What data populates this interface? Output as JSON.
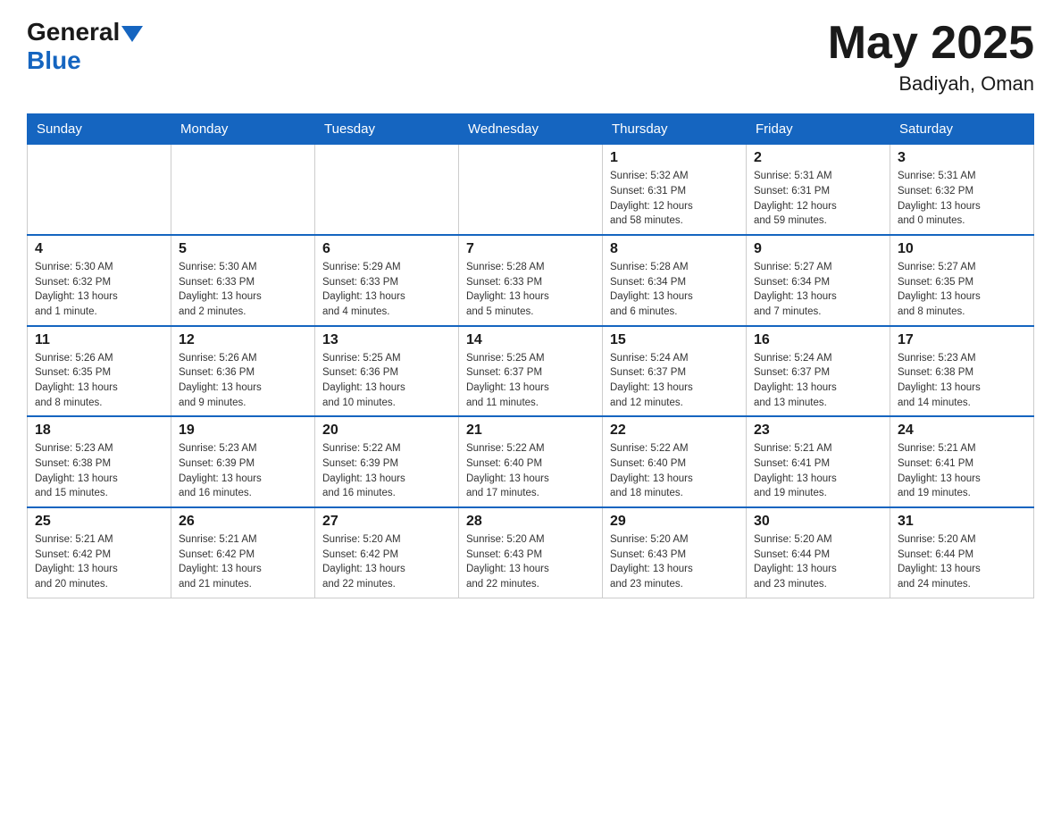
{
  "header": {
    "logo_general": "General",
    "logo_blue": "Blue",
    "month_year": "May 2025",
    "location": "Badiyah, Oman"
  },
  "weekdays": [
    "Sunday",
    "Monday",
    "Tuesday",
    "Wednesday",
    "Thursday",
    "Friday",
    "Saturday"
  ],
  "weeks": [
    [
      {
        "day": "",
        "info": ""
      },
      {
        "day": "",
        "info": ""
      },
      {
        "day": "",
        "info": ""
      },
      {
        "day": "",
        "info": ""
      },
      {
        "day": "1",
        "info": "Sunrise: 5:32 AM\nSunset: 6:31 PM\nDaylight: 12 hours\nand 58 minutes."
      },
      {
        "day": "2",
        "info": "Sunrise: 5:31 AM\nSunset: 6:31 PM\nDaylight: 12 hours\nand 59 minutes."
      },
      {
        "day": "3",
        "info": "Sunrise: 5:31 AM\nSunset: 6:32 PM\nDaylight: 13 hours\nand 0 minutes."
      }
    ],
    [
      {
        "day": "4",
        "info": "Sunrise: 5:30 AM\nSunset: 6:32 PM\nDaylight: 13 hours\nand 1 minute."
      },
      {
        "day": "5",
        "info": "Sunrise: 5:30 AM\nSunset: 6:33 PM\nDaylight: 13 hours\nand 2 minutes."
      },
      {
        "day": "6",
        "info": "Sunrise: 5:29 AM\nSunset: 6:33 PM\nDaylight: 13 hours\nand 4 minutes."
      },
      {
        "day": "7",
        "info": "Sunrise: 5:28 AM\nSunset: 6:33 PM\nDaylight: 13 hours\nand 5 minutes."
      },
      {
        "day": "8",
        "info": "Sunrise: 5:28 AM\nSunset: 6:34 PM\nDaylight: 13 hours\nand 6 minutes."
      },
      {
        "day": "9",
        "info": "Sunrise: 5:27 AM\nSunset: 6:34 PM\nDaylight: 13 hours\nand 7 minutes."
      },
      {
        "day": "10",
        "info": "Sunrise: 5:27 AM\nSunset: 6:35 PM\nDaylight: 13 hours\nand 8 minutes."
      }
    ],
    [
      {
        "day": "11",
        "info": "Sunrise: 5:26 AM\nSunset: 6:35 PM\nDaylight: 13 hours\nand 8 minutes."
      },
      {
        "day": "12",
        "info": "Sunrise: 5:26 AM\nSunset: 6:36 PM\nDaylight: 13 hours\nand 9 minutes."
      },
      {
        "day": "13",
        "info": "Sunrise: 5:25 AM\nSunset: 6:36 PM\nDaylight: 13 hours\nand 10 minutes."
      },
      {
        "day": "14",
        "info": "Sunrise: 5:25 AM\nSunset: 6:37 PM\nDaylight: 13 hours\nand 11 minutes."
      },
      {
        "day": "15",
        "info": "Sunrise: 5:24 AM\nSunset: 6:37 PM\nDaylight: 13 hours\nand 12 minutes."
      },
      {
        "day": "16",
        "info": "Sunrise: 5:24 AM\nSunset: 6:37 PM\nDaylight: 13 hours\nand 13 minutes."
      },
      {
        "day": "17",
        "info": "Sunrise: 5:23 AM\nSunset: 6:38 PM\nDaylight: 13 hours\nand 14 minutes."
      }
    ],
    [
      {
        "day": "18",
        "info": "Sunrise: 5:23 AM\nSunset: 6:38 PM\nDaylight: 13 hours\nand 15 minutes."
      },
      {
        "day": "19",
        "info": "Sunrise: 5:23 AM\nSunset: 6:39 PM\nDaylight: 13 hours\nand 16 minutes."
      },
      {
        "day": "20",
        "info": "Sunrise: 5:22 AM\nSunset: 6:39 PM\nDaylight: 13 hours\nand 16 minutes."
      },
      {
        "day": "21",
        "info": "Sunrise: 5:22 AM\nSunset: 6:40 PM\nDaylight: 13 hours\nand 17 minutes."
      },
      {
        "day": "22",
        "info": "Sunrise: 5:22 AM\nSunset: 6:40 PM\nDaylight: 13 hours\nand 18 minutes."
      },
      {
        "day": "23",
        "info": "Sunrise: 5:21 AM\nSunset: 6:41 PM\nDaylight: 13 hours\nand 19 minutes."
      },
      {
        "day": "24",
        "info": "Sunrise: 5:21 AM\nSunset: 6:41 PM\nDaylight: 13 hours\nand 19 minutes."
      }
    ],
    [
      {
        "day": "25",
        "info": "Sunrise: 5:21 AM\nSunset: 6:42 PM\nDaylight: 13 hours\nand 20 minutes."
      },
      {
        "day": "26",
        "info": "Sunrise: 5:21 AM\nSunset: 6:42 PM\nDaylight: 13 hours\nand 21 minutes."
      },
      {
        "day": "27",
        "info": "Sunrise: 5:20 AM\nSunset: 6:42 PM\nDaylight: 13 hours\nand 22 minutes."
      },
      {
        "day": "28",
        "info": "Sunrise: 5:20 AM\nSunset: 6:43 PM\nDaylight: 13 hours\nand 22 minutes."
      },
      {
        "day": "29",
        "info": "Sunrise: 5:20 AM\nSunset: 6:43 PM\nDaylight: 13 hours\nand 23 minutes."
      },
      {
        "day": "30",
        "info": "Sunrise: 5:20 AM\nSunset: 6:44 PM\nDaylight: 13 hours\nand 23 minutes."
      },
      {
        "day": "31",
        "info": "Sunrise: 5:20 AM\nSunset: 6:44 PM\nDaylight: 13 hours\nand 24 minutes."
      }
    ]
  ]
}
